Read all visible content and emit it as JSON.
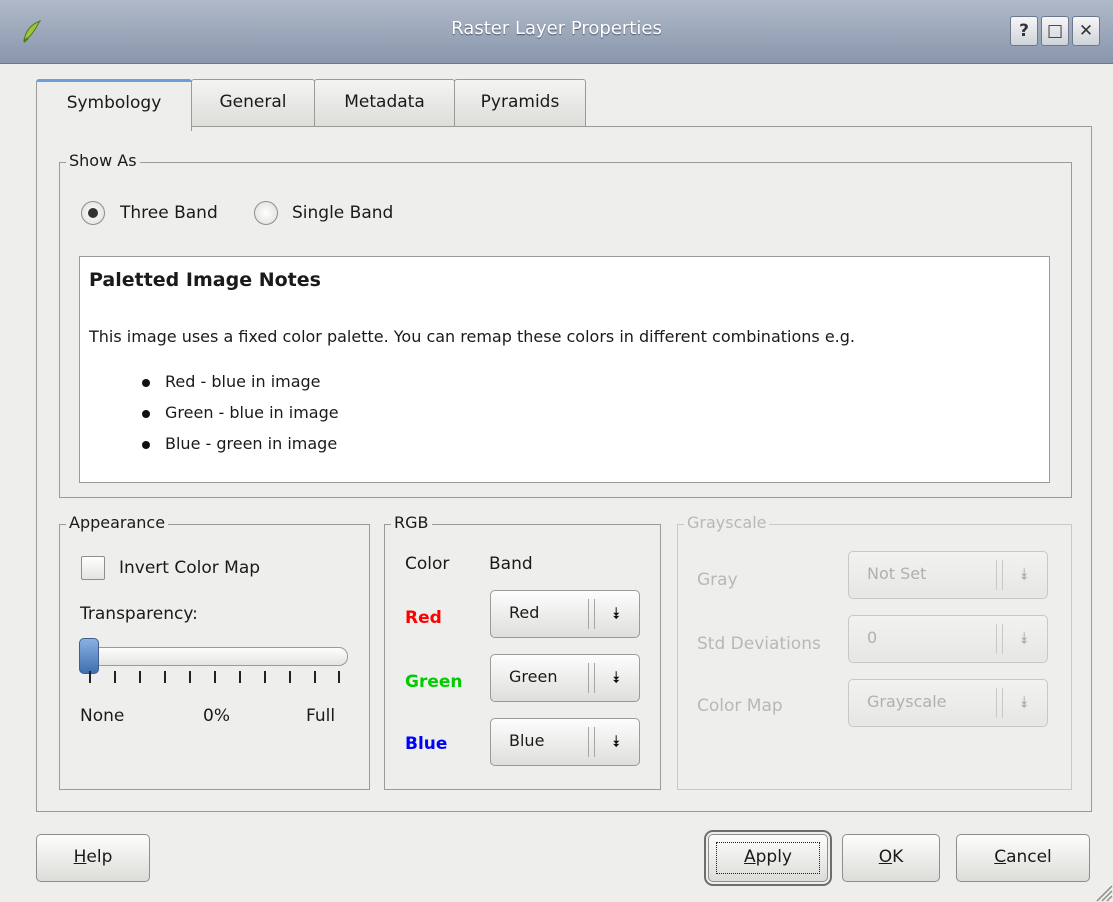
{
  "window": {
    "title": "Raster Layer Properties",
    "buttons": [
      "?",
      "□",
      "✕"
    ]
  },
  "tabs": [
    {
      "label": "Symbology",
      "active": true
    },
    {
      "label": "General",
      "active": false
    },
    {
      "label": "Metadata",
      "active": false
    },
    {
      "label": "Pyramids",
      "active": false
    }
  ],
  "show_as": {
    "legend": "Show As",
    "options": [
      {
        "label": "Three Band",
        "selected": true
      },
      {
        "label": "Single Band",
        "selected": false
      }
    ]
  },
  "notes": {
    "heading": "Paletted Image Notes",
    "body": "This image uses a fixed color palette. You can remap these colors in different combinations e.g.",
    "items": [
      "Red - blue in image",
      "Green - blue in image",
      "Blue - green in image"
    ]
  },
  "appearance": {
    "legend": "Appearance",
    "invert_label": "Invert Color Map",
    "invert_checked": false,
    "transparency_label": "Transparency:",
    "transparency_value": 0,
    "scale_min": "None",
    "scale_value": "0%",
    "scale_max": "Full"
  },
  "rgb": {
    "legend": "RGB",
    "col_color": "Color",
    "col_band": "Band",
    "rows": [
      {
        "label": "Red",
        "color": "#ff0000",
        "band": "Red"
      },
      {
        "label": "Green",
        "color": "#00cc00",
        "band": "Green"
      },
      {
        "label": "Blue",
        "color": "#0000ff",
        "band": "Blue"
      }
    ]
  },
  "grayscale": {
    "legend": "Grayscale",
    "enabled": false,
    "rows": [
      {
        "label": "Gray",
        "value": "Not Set"
      },
      {
        "label": "Std Deviations",
        "value": "0"
      },
      {
        "label": "Color Map",
        "value": "Grayscale"
      }
    ]
  },
  "footer": {
    "help": "Help",
    "apply": "Apply",
    "ok": "OK",
    "cancel": "Cancel"
  }
}
